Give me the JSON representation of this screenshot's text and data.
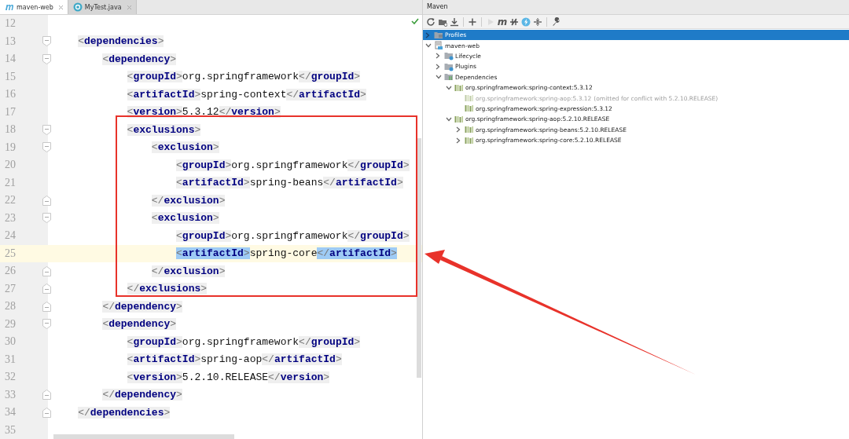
{
  "editor": {
    "tabs": [
      {
        "kind": "maven",
        "label": "maven-web",
        "selected": true,
        "closable": true
      },
      {
        "kind": "class",
        "label": "MyTest.java",
        "selected": false,
        "closable": true
      }
    ],
    "lines": [
      {
        "number": "12",
        "kind": "plain",
        "current": false
      },
      {
        "number": "13",
        "kind": "fold-start",
        "current": false,
        "matched": false,
        "tokens": [
          {
            "kind": "p",
            "text": "<"
          },
          {
            "kind": "t",
            "text": "dependencies"
          },
          {
            "kind": "p",
            "text": ">"
          }
        ],
        "children": [
          {
            "number": "14",
            "kind": "fold-start",
            "current": false,
            "matched": false,
            "tokens": [
              {
                "kind": "p",
                "text": "<"
              },
              {
                "kind": "t",
                "text": "dependency"
              },
              {
                "kind": "p",
                "text": ">"
              }
            ],
            "children": [
              {
                "number": "15",
                "kind": "plain",
                "current": false,
                "matched": false,
                "tokens": [
                  {
                    "kind": "p",
                    "text": "<"
                  },
                  {
                    "kind": "t",
                    "text": "groupId"
                  },
                  {
                    "kind": "p",
                    "text": ">"
                  },
                  {
                    "kind": "x",
                    "text": "org.springframework"
                  },
                  {
                    "kind": "p",
                    "text": "</"
                  },
                  {
                    "kind": "t",
                    "text": "groupId"
                  },
                  {
                    "kind": "p",
                    "text": ">"
                  }
                ]
              },
              {
                "number": "16",
                "kind": "plain",
                "current": false,
                "matched": false,
                "tokens": [
                  {
                    "kind": "p",
                    "text": "<"
                  },
                  {
                    "kind": "t",
                    "text": "artifactId"
                  },
                  {
                    "kind": "p",
                    "text": ">"
                  },
                  {
                    "kind": "x",
                    "text": "spring-context"
                  },
                  {
                    "kind": "p",
                    "text": "</"
                  },
                  {
                    "kind": "t",
                    "text": "artifactId"
                  },
                  {
                    "kind": "p",
                    "text": ">"
                  }
                ]
              },
              {
                "number": "17",
                "kind": "plain",
                "current": false,
                "matched": false,
                "tokens": [
                  {
                    "kind": "p",
                    "text": "<"
                  },
                  {
                    "kind": "t",
                    "text": "version"
                  },
                  {
                    "kind": "p",
                    "text": ">"
                  },
                  {
                    "kind": "x",
                    "text": "5.3.12"
                  },
                  {
                    "kind": "p",
                    "text": "</"
                  },
                  {
                    "kind": "t",
                    "text": "version"
                  },
                  {
                    "kind": "p",
                    "text": ">"
                  }
                ]
              },
              {
                "number": "18",
                "kind": "fold-start",
                "current": false,
                "matched": false,
                "tokens": [
                  {
                    "kind": "p",
                    "text": "<"
                  },
                  {
                    "kind": "t",
                    "text": "exclusions"
                  },
                  {
                    "kind": "p",
                    "text": ">"
                  }
                ],
                "children": [
                  {
                    "number": "19",
                    "kind": "fold-start",
                    "current": false,
                    "matched": false,
                    "tokens": [
                      {
                        "kind": "p",
                        "text": "<"
                      },
                      {
                        "kind": "t",
                        "text": "exclusion"
                      },
                      {
                        "kind": "p",
                        "text": ">"
                      }
                    ],
                    "children": [
                      {
                        "number": "20",
                        "kind": "plain",
                        "current": false,
                        "matched": false,
                        "tokens": [
                          {
                            "kind": "p",
                            "text": "<"
                          },
                          {
                            "kind": "t",
                            "text": "groupId"
                          },
                          {
                            "kind": "p",
                            "text": ">"
                          },
                          {
                            "kind": "x",
                            "text": "org.springframework"
                          },
                          {
                            "kind": "p",
                            "text": "</"
                          },
                          {
                            "kind": "t",
                            "text": "groupId"
                          },
                          {
                            "kind": "p",
                            "text": ">"
                          }
                        ]
                      },
                      {
                        "number": "21",
                        "kind": "plain",
                        "current": false,
                        "matched": false,
                        "tokens": [
                          {
                            "kind": "p",
                            "text": "<"
                          },
                          {
                            "kind": "t",
                            "text": "artifactId"
                          },
                          {
                            "kind": "p",
                            "text": ">"
                          },
                          {
                            "kind": "x",
                            "text": "spring-beans"
                          },
                          {
                            "kind": "p",
                            "text": "</"
                          },
                          {
                            "kind": "t",
                            "text": "artifactId"
                          },
                          {
                            "kind": "p",
                            "text": ">"
                          }
                        ]
                      }
                    ]
                  },
                  {
                    "number": "22",
                    "kind": "fold-end",
                    "current": false,
                    "matched": false,
                    "tokens": [
                      {
                        "kind": "p",
                        "text": "</"
                      },
                      {
                        "kind": "t",
                        "text": "exclusion"
                      },
                      {
                        "kind": "p",
                        "text": ">"
                      }
                    ]
                  },
                  {
                    "number": "23",
                    "kind": "fold-start",
                    "current": false,
                    "matched": false,
                    "tokens": [
                      {
                        "kind": "p",
                        "text": "<"
                      },
                      {
                        "kind": "t",
                        "text": "exclusion"
                      },
                      {
                        "kind": "p",
                        "text": ">"
                      }
                    ],
                    "children": [
                      {
                        "number": "24",
                        "kind": "plain",
                        "current": false,
                        "matched": false,
                        "tokens": [
                          {
                            "kind": "p",
                            "text": "<"
                          },
                          {
                            "kind": "t",
                            "text": "groupId"
                          },
                          {
                            "kind": "p",
                            "text": ">"
                          },
                          {
                            "kind": "x",
                            "text": "org.springframework"
                          },
                          {
                            "kind": "p",
                            "text": "</"
                          },
                          {
                            "kind": "t",
                            "text": "groupId"
                          },
                          {
                            "kind": "p",
                            "text": ">"
                          }
                        ]
                      },
                      {
                        "number": "25",
                        "kind": "plain",
                        "current": true,
                        "matched": true,
                        "tokens": [
                          {
                            "kind": "p",
                            "text": "<"
                          },
                          {
                            "kind": "t",
                            "text": "artifactId"
                          },
                          {
                            "kind": "p",
                            "text": ">"
                          },
                          {
                            "kind": "x",
                            "text": "spring-core"
                          },
                          {
                            "kind": "p",
                            "text": "</"
                          },
                          {
                            "kind": "t",
                            "text": "artifactId"
                          },
                          {
                            "kind": "p",
                            "text": ">"
                          }
                        ]
                      }
                    ]
                  },
                  {
                    "number": "26",
                    "kind": "fold-end",
                    "current": false,
                    "matched": false,
                    "tokens": [
                      {
                        "kind": "p",
                        "text": "</"
                      },
                      {
                        "kind": "t",
                        "text": "exclusion"
                      },
                      {
                        "kind": "p",
                        "text": ">"
                      }
                    ]
                  }
                ]
              },
              {
                "number": "27",
                "kind": "fold-end",
                "current": false,
                "matched": false,
                "tokens": [
                  {
                    "kind": "p",
                    "text": "</"
                  },
                  {
                    "kind": "t",
                    "text": "exclusions"
                  },
                  {
                    "kind": "p",
                    "text": ">"
                  }
                ]
              }
            ]
          },
          {
            "number": "28",
            "kind": "fold-end",
            "current": false,
            "matched": false,
            "tokens": [
              {
                "kind": "p",
                "text": "</"
              },
              {
                "kind": "t",
                "text": "dependency"
              },
              {
                "kind": "p",
                "text": ">"
              }
            ]
          },
          {
            "number": "29",
            "kind": "fold-start",
            "current": false,
            "matched": false,
            "tokens": [
              {
                "kind": "p",
                "text": "<"
              },
              {
                "kind": "t",
                "text": "dependency"
              },
              {
                "kind": "p",
                "text": ">"
              }
            ],
            "children": [
              {
                "number": "30",
                "kind": "plain",
                "current": false,
                "matched": false,
                "tokens": [
                  {
                    "kind": "p",
                    "text": "<"
                  },
                  {
                    "kind": "t",
                    "text": "groupId"
                  },
                  {
                    "kind": "p",
                    "text": ">"
                  },
                  {
                    "kind": "x",
                    "text": "org.springframework"
                  },
                  {
                    "kind": "p",
                    "text": "</"
                  },
                  {
                    "kind": "t",
                    "text": "groupId"
                  },
                  {
                    "kind": "p",
                    "text": ">"
                  }
                ]
              },
              {
                "number": "31",
                "kind": "plain",
                "current": false,
                "matched": false,
                "tokens": [
                  {
                    "kind": "p",
                    "text": "<"
                  },
                  {
                    "kind": "t",
                    "text": "artifactId"
                  },
                  {
                    "kind": "p",
                    "text": ">"
                  },
                  {
                    "kind": "x",
                    "text": "spring-aop"
                  },
                  {
                    "kind": "p",
                    "text": "</"
                  },
                  {
                    "kind": "t",
                    "text": "artifactId"
                  },
                  {
                    "kind": "p",
                    "text": ">"
                  }
                ]
              },
              {
                "number": "32",
                "kind": "plain",
                "current": false,
                "matched": false,
                "tokens": [
                  {
                    "kind": "p",
                    "text": "<"
                  },
                  {
                    "kind": "t",
                    "text": "version"
                  },
                  {
                    "kind": "p",
                    "text": ">"
                  },
                  {
                    "kind": "x",
                    "text": "5.2.10.RELEASE"
                  },
                  {
                    "kind": "p",
                    "text": "</"
                  },
                  {
                    "kind": "t",
                    "text": "version"
                  },
                  {
                    "kind": "p",
                    "text": ">"
                  }
                ]
              }
            ]
          },
          {
            "number": "33",
            "kind": "fold-end",
            "current": false,
            "matched": false,
            "tokens": [
              {
                "kind": "p",
                "text": "</"
              },
              {
                "kind": "t",
                "text": "dependency"
              },
              {
                "kind": "p",
                "text": ">"
              }
            ]
          }
        ]
      },
      {
        "number": "34",
        "kind": "fold-end",
        "current": false,
        "matched": false,
        "tokens": [
          {
            "kind": "p",
            "text": "</"
          },
          {
            "kind": "t",
            "text": "dependencies"
          },
          {
            "kind": "p",
            "text": ">"
          }
        ]
      },
      {
        "number": "35",
        "kind": "plain",
        "current": false
      }
    ]
  },
  "maven": {
    "title": "Maven",
    "toolbar": [
      {
        "kind": "refresh",
        "disabled": false
      },
      {
        "kind": "folder-add",
        "disabled": false
      },
      {
        "kind": "download",
        "disabled": false
      },
      {
        "kind": "separator"
      },
      {
        "kind": "plus",
        "disabled": false
      },
      {
        "kind": "separator"
      },
      {
        "kind": "run",
        "disabled": true
      },
      {
        "kind": "glyph",
        "glyph": "m",
        "disabled": false
      },
      {
        "kind": "toggle",
        "disabled": false
      },
      {
        "kind": "bolt",
        "disabled": false
      },
      {
        "kind": "collapse",
        "disabled": false
      },
      {
        "kind": "separator"
      },
      {
        "kind": "wrench",
        "disabled": false
      }
    ],
    "tree": [
      {
        "kind": "profiles",
        "label": "Profiles",
        "expanded": false,
        "selected": true,
        "disabled": false
      },
      {
        "kind": "module",
        "label": "maven-web",
        "expanded": true,
        "selected": false,
        "disabled": false,
        "children": [
          {
            "kind": "lifecycle",
            "label": "Lifecycle",
            "expanded": false,
            "selected": false,
            "disabled": false
          },
          {
            "kind": "plugins",
            "label": "Plugins",
            "expanded": false,
            "selected": false,
            "disabled": false
          },
          {
            "kind": "dependencies",
            "label": "Dependencies",
            "expanded": true,
            "selected": false,
            "disabled": false,
            "children": [
              {
                "kind": "library",
                "label": "org.springframework:spring-context:5.3.12",
                "expanded": true,
                "selected": false,
                "disabled": false,
                "children": [
                  {
                    "kind": "library",
                    "label": "org.springframework:spring-aop:5.3.12",
                    "note": "(omitted for conflict with 5.2.10.RELEASE)",
                    "selected": false,
                    "disabled": true
                  },
                  {
                    "kind": "library",
                    "label": "org.springframework:spring-expression:5.3.12",
                    "selected": false,
                    "disabled": false
                  }
                ]
              },
              {
                "kind": "library",
                "label": "org.springframework:spring-aop:5.2.10.RELEASE",
                "expanded": true,
                "selected": false,
                "disabled": false,
                "children": [
                  {
                    "kind": "library",
                    "label": "org.springframework:spring-beans:5.2.10.RELEASE",
                    "expanded": false,
                    "selected": false,
                    "disabled": false
                  },
                  {
                    "kind": "library",
                    "label": "org.springframework:spring-core:5.2.10.RELEASE",
                    "expanded": false,
                    "selected": false,
                    "disabled": false
                  }
                ]
              }
            ]
          }
        ]
      }
    ]
  },
  "annotations": {
    "frame": true,
    "arrow": true
  }
}
